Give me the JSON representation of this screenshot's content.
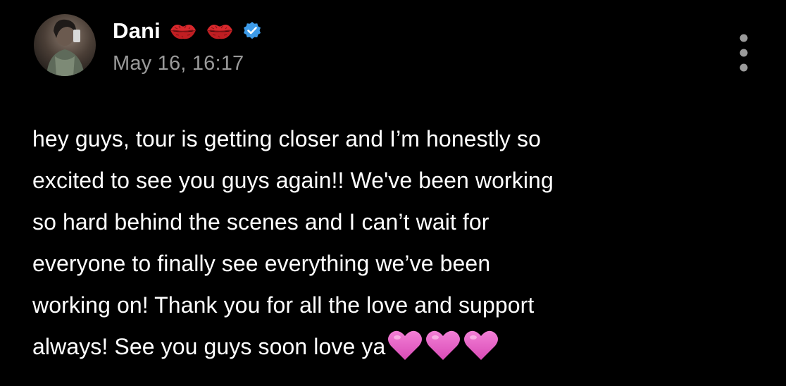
{
  "post": {
    "author": {
      "display_name": "Dani",
      "verified": true,
      "name_emojis": [
        "kiss-mark-icon",
        "kiss-mark-icon"
      ]
    },
    "timestamp": "May 16, 16:17",
    "body_lines": [
      "hey guys, tour is getting closer and I’m honestly so",
      "excited to see you guys again!! We've been working",
      "so hard behind the scenes and I can’t wait for",
      "everyone to finally see everything we’ve been",
      "working on! Thank you for all the love and support",
      "always! See you guys soon love ya"
    ],
    "trailing_emojis": [
      "pink-heart-icon",
      "pink-heart-icon",
      "pink-heart-icon"
    ]
  },
  "colors": {
    "background": "#000000",
    "text": "#ffffff",
    "timestamp": "#9a9a9a",
    "verified": "#3d9be9",
    "heart": "#e85bc4",
    "kiss": "#d8282c"
  }
}
